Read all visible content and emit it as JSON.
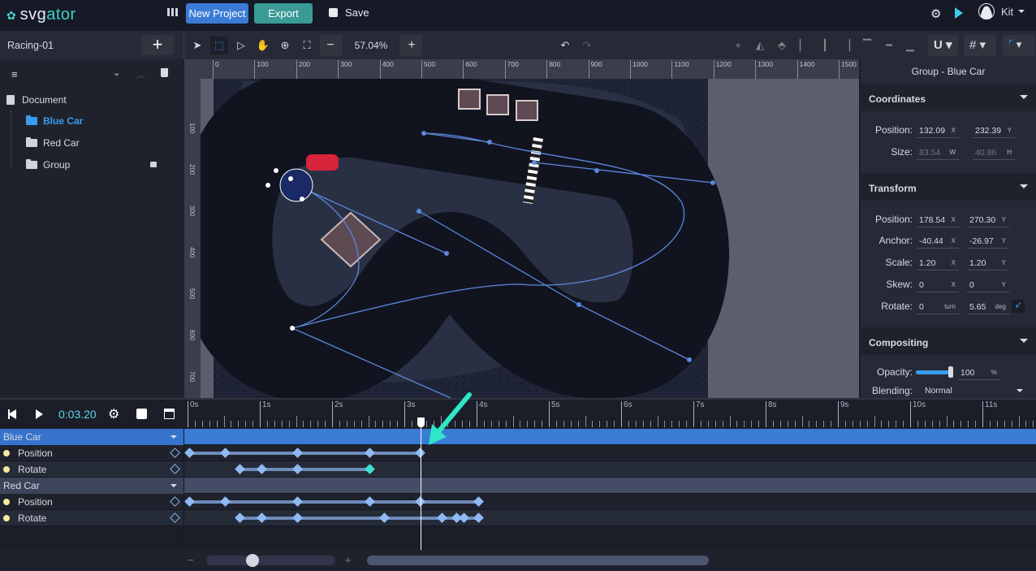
{
  "app": {
    "logo_text_a": "svg",
    "logo_text_b": "ator",
    "new_project": "New Project",
    "export": "Export",
    "save": "Save",
    "user": "Kit"
  },
  "colors": {
    "accent": "#3a7bd5",
    "export": "#3a9a96",
    "teal": "#3ed3c8",
    "keyframe": "#8fb9f2",
    "keyframe_selected": "#3ee0d0"
  },
  "toolbar": {
    "zoom": "57.04%"
  },
  "project": {
    "name": "Racing-01"
  },
  "layers": {
    "root": "Document",
    "items": [
      {
        "label": "Blue Car",
        "selected": true
      },
      {
        "label": "Red Car",
        "selected": false
      },
      {
        "label": "Group",
        "selected": false,
        "locked": true
      }
    ]
  },
  "ruler": {
    "h": [
      "0",
      "100",
      "200",
      "300",
      "400",
      "500",
      "600",
      "700",
      "800",
      "900",
      "1000",
      "1100",
      "1200",
      "1300",
      "1400",
      "1500"
    ],
    "v": [
      "100",
      "200",
      "300",
      "400",
      "500",
      "600",
      "700"
    ]
  },
  "inspector": {
    "title": "Group - Blue Car",
    "coordinates": {
      "heading": "Coordinates",
      "position_label": "Position:",
      "pos_x": "132.09",
      "pos_y": "232.39",
      "size_label": "Size:",
      "w": "83.54",
      "h": "40.86"
    },
    "transform": {
      "heading": "Transform",
      "position_label": "Position:",
      "pos_x": "178.54",
      "pos_y": "270.30",
      "anchor_label": "Anchor:",
      "anchor_x": "-40.44",
      "anchor_y": "-26.97",
      "scale_label": "Scale:",
      "scale_x": "1.20",
      "scale_y": "1.20",
      "skew_label": "Skew:",
      "skew_x": "0",
      "skew_y": "0",
      "rotate_label": "Rotate:",
      "rotate_turn": "0",
      "rotate_deg": "5.65"
    },
    "compositing": {
      "heading": "Compositing",
      "opacity_label": "Opacity:",
      "opacity": "100",
      "opacity_unit": "%",
      "blending_label": "Blending:",
      "blending": "Normal"
    },
    "units": {
      "x": "X",
      "y": "Y",
      "w": "W",
      "h": "H",
      "turn": "turn",
      "deg": "deg"
    }
  },
  "timeline": {
    "time": "0:03.20",
    "playhead_s": 3.2,
    "ticks": [
      "0s",
      "1s",
      "2s",
      "3s",
      "4s",
      "5s",
      "6s",
      "7s",
      "8s",
      "9s",
      "10s",
      "11s"
    ],
    "groups": [
      {
        "label": "Blue Car",
        "tracks": [
          {
            "label": "Position",
            "keys": [
              0,
              0.5,
              1.5,
              2.5,
              3.2
            ]
          },
          {
            "label": "Rotate",
            "keys": [
              0.7,
              1.0,
              1.5,
              2.5
            ],
            "selected_key": 2.5
          }
        ]
      },
      {
        "label": "Red Car",
        "tracks": [
          {
            "label": "Position",
            "keys": [
              0,
              0.5,
              1.5,
              2.5,
              3.2,
              4.0
            ]
          },
          {
            "label": "Rotate",
            "keys": [
              0.7,
              1.0,
              1.5,
              2.7,
              3.5,
              3.7,
              3.8,
              4.0
            ]
          }
        ]
      }
    ],
    "zoom_minus": "−",
    "zoom_plus": "+"
  }
}
